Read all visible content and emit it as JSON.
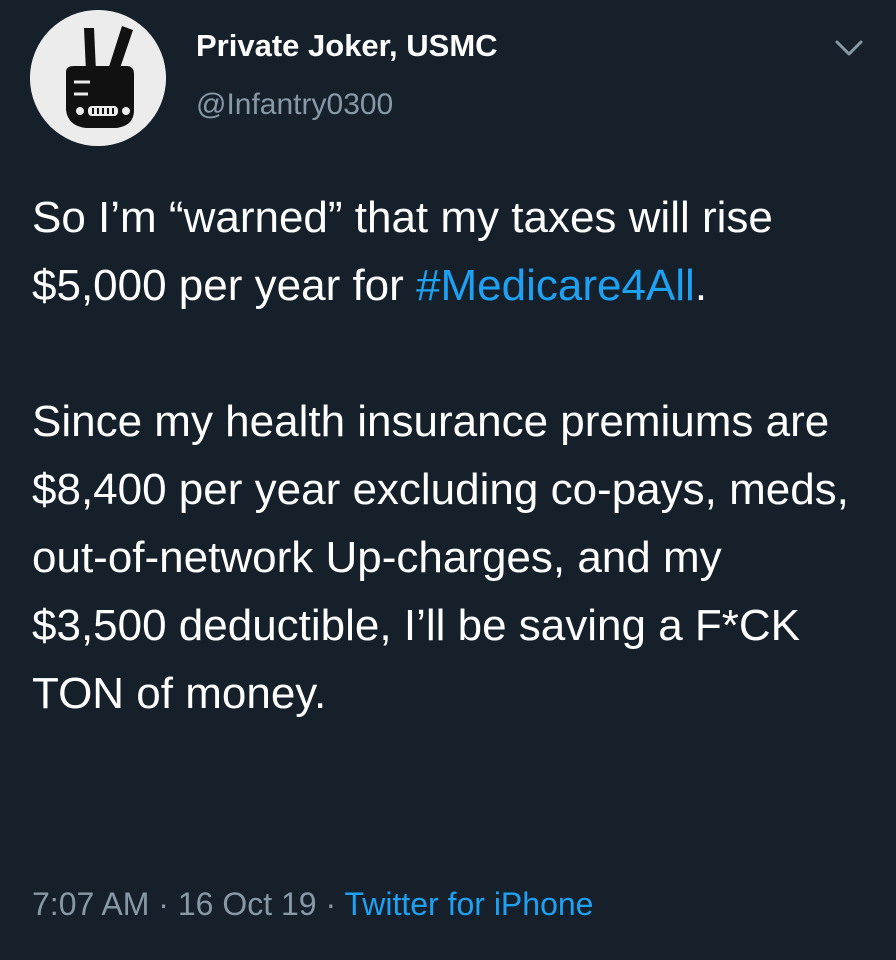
{
  "user": {
    "display_name": "Private Joker, USMC",
    "handle": "@Infantry0300",
    "avatar_icon": "peace-sign-hand-icon"
  },
  "menu": {
    "icon": "chevron-down-icon"
  },
  "tweet": {
    "p1_before": "So I’m “warned” that my taxes will rise $5,000 per year for ",
    "hashtag": "#Medicare4All",
    "p1_after": ".",
    "p2": "Since my health insurance premiums are $8,400 per year excluding co-pays, meds, out-of-network Up-charges, and my $3,500 deductible, I’ll be saving a F*CK TON of money."
  },
  "meta": {
    "time": "7:07 AM",
    "sep1": " · ",
    "date": "16 Oct 19",
    "sep2": " · ",
    "source": "Twitter for iPhone"
  },
  "colors": {
    "background": "#15202b",
    "text": "#ffffff",
    "secondary": "#8899a6",
    "link": "#1da1f2"
  }
}
